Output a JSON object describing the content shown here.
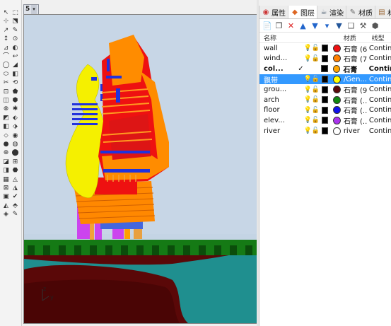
{
  "viewport": {
    "number": "5",
    "dropdown_glyph": "▾",
    "axis_z": "z",
    "axis_y": "y"
  },
  "toolbar_icons": [
    [
      "↖",
      "⬚"
    ],
    [
      "⊹",
      "⬔"
    ],
    [
      "↗",
      "✎"
    ],
    [
      "↕",
      "⊙"
    ],
    [
      "⊿",
      "◐"
    ],
    [
      "⌒",
      "↩"
    ],
    [
      "◯",
      "◢"
    ],
    [
      "⬭",
      "◧"
    ],
    [
      "✂",
      "⟲"
    ],
    [
      "⊡",
      "⬟"
    ],
    [
      "◫",
      "⬢"
    ],
    [
      "⊗",
      "✱"
    ],
    [
      "◩",
      "⬖"
    ],
    [
      "◧",
      "⬗"
    ],
    [
      "⬦",
      "◉"
    ],
    [
      "●",
      "◍"
    ],
    [
      "⊕",
      "⬤"
    ],
    [
      "◪",
      "⊞"
    ],
    [
      "◨",
      "⬣"
    ],
    [
      "▦",
      "◬"
    ],
    [
      "⊠",
      "◮"
    ],
    [
      "▣",
      "✔"
    ],
    [
      "◭",
      "⬘"
    ],
    [
      "◈",
      "✎"
    ]
  ],
  "panel": {
    "tabs": [
      {
        "icon": "◉",
        "label": "属性",
        "color": "#cc3333"
      },
      {
        "icon": "◆",
        "label": "图层",
        "color": "#dd6622"
      },
      {
        "icon": "☕",
        "label": "渲染",
        "color": "#556677"
      },
      {
        "icon": "✎",
        "label": "材质",
        "color": "#666666"
      },
      {
        "icon": "▤",
        "label": "材...",
        "color": "#996633"
      }
    ],
    "layer_tools": [
      {
        "icon": "📄",
        "color": "#333333"
      },
      {
        "icon": "❐",
        "color": "#333333"
      },
      {
        "icon": "✕",
        "color": "#dd2222"
      },
      {
        "icon": "▲",
        "color": "#2266cc"
      },
      {
        "icon": "▼",
        "color": "#2266cc"
      },
      {
        "icon": "▾",
        "color": "#2266cc"
      },
      {
        "icon": "▼",
        "color": "#225599"
      },
      {
        "icon": "❑",
        "color": "#555555"
      },
      {
        "icon": "⚒",
        "color": "#555555"
      },
      {
        "icon": "⬢",
        "color": "#555555"
      }
    ],
    "header": {
      "name": "名称",
      "material": "材质",
      "linetype": "线型"
    },
    "layers": [
      {
        "name": "wall",
        "current": false,
        "selected": false,
        "color": "#ee1111",
        "material": "石膏 (6)",
        "linetype": "Continu"
      },
      {
        "name": "wind...",
        "current": false,
        "selected": false,
        "color": "#ff7f00",
        "material": "石膏 (7)",
        "linetype": "Continu"
      },
      {
        "name": "col...",
        "current": true,
        "selected": false,
        "color": "#ffa500",
        "material": "石膏",
        "linetype": "Continu"
      },
      {
        "name": "飘带",
        "current": false,
        "selected": true,
        "color": "#ffff00",
        "material": "/Gen...",
        "linetype": "Continu"
      },
      {
        "name": "grou...",
        "current": false,
        "selected": false,
        "color": "#5a0a0a",
        "material": "石膏 (9)",
        "linetype": "Continu"
      },
      {
        "name": "arch",
        "current": false,
        "selected": false,
        "color": "#118811",
        "material": "石膏 (...",
        "linetype": "Continu"
      },
      {
        "name": "floor",
        "current": false,
        "selected": false,
        "color": "#1111ee",
        "material": "石膏 (...",
        "linetype": "Continu"
      },
      {
        "name": "elev...",
        "current": false,
        "selected": false,
        "color": "#aa33ee",
        "material": "石膏 (...",
        "linetype": "Continu"
      },
      {
        "name": "river",
        "current": false,
        "selected": false,
        "color": "#ffffff",
        "material": "river",
        "linetype": "Continu"
      }
    ]
  }
}
